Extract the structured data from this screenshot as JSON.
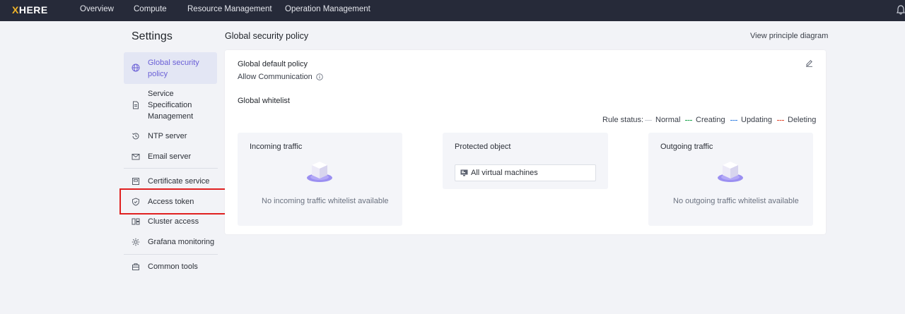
{
  "app": {
    "logo_x": "X",
    "logo_rest": "HERE"
  },
  "nav": {
    "items": [
      "Overview",
      "Compute",
      "Resource Management",
      "Operation Management"
    ]
  },
  "sidebar": {
    "title": "Settings",
    "items": [
      {
        "label": "Global security policy",
        "icon": "globe-icon",
        "active": true
      },
      {
        "label": "Service Specification Management",
        "icon": "document-icon"
      },
      {
        "label": "NTP server",
        "icon": "clock-history-icon"
      },
      {
        "label": "Email server",
        "icon": "mail-icon"
      },
      {
        "label": "Certificate service",
        "icon": "certificate-icon"
      },
      {
        "label": "Access token",
        "icon": "shield-icon"
      },
      {
        "label": "Cluster access",
        "icon": "cluster-icon"
      },
      {
        "label": "Grafana monitoring",
        "icon": "gear-icon"
      },
      {
        "label": "Common tools",
        "icon": "toolbox-icon"
      }
    ]
  },
  "main": {
    "title": "Global security policy",
    "principle_link": "View principle diagram",
    "policy": {
      "title": "Global default policy",
      "value": "Allow Communication"
    },
    "whitelist": {
      "title": "Global whitelist",
      "rule_status_label": "Rule status:",
      "statuses": [
        {
          "label": "Normal",
          "color": "#c9ccd3"
        },
        {
          "label": "Creating",
          "color": "#1aa34a"
        },
        {
          "label": "Updating",
          "color": "#2f7de1"
        },
        {
          "label": "Deleting",
          "color": "#e0452c"
        }
      ]
    },
    "incoming": {
      "title": "Incoming traffic",
      "empty": "No incoming traffic whitelist available"
    },
    "protected": {
      "title": "Protected object",
      "value": "All virtual machines"
    },
    "outgoing": {
      "title": "Outgoing traffic",
      "empty": "No outgoing traffic whitelist available"
    }
  },
  "colors": {
    "accent": "#6a5fd6",
    "topbar": "#262a39",
    "highlight": "#e02020"
  }
}
